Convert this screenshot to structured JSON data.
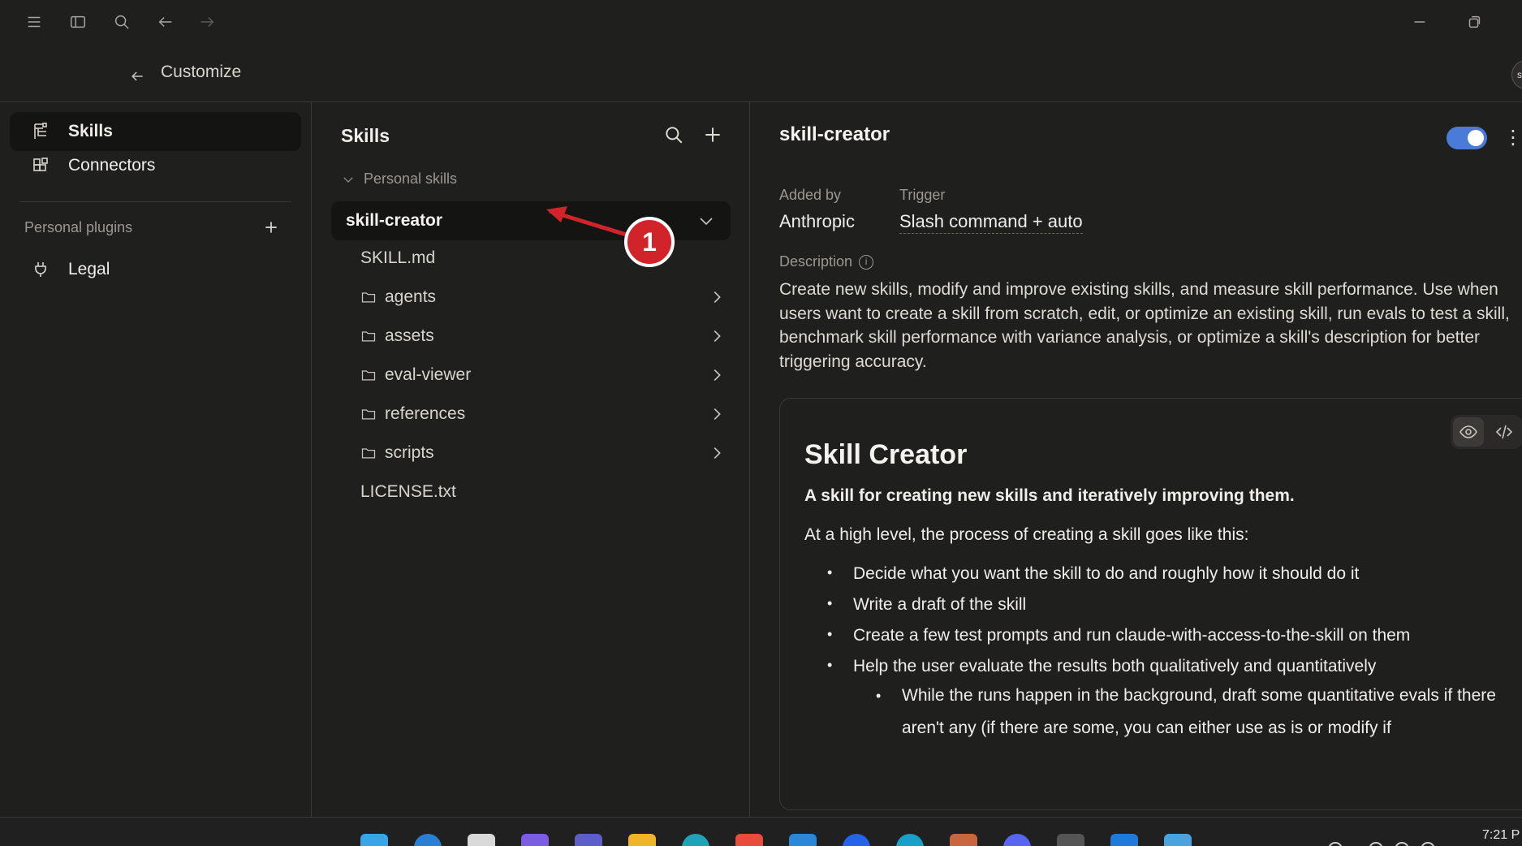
{
  "header": {
    "title": "Customize"
  },
  "avatar": {
    "initial": "s"
  },
  "nav": {
    "items": [
      {
        "label": "Skills",
        "icon": "skills-icon",
        "active": true
      },
      {
        "label": "Connectors",
        "icon": "connectors-icon",
        "active": false
      }
    ],
    "plugins_label": "Personal plugins",
    "plugins": [
      {
        "label": "Legal",
        "icon": "plug-icon"
      }
    ]
  },
  "tree": {
    "title": "Skills",
    "group_label": "Personal skills",
    "selected_skill": "skill-creator",
    "files": [
      {
        "name": "SKILL.md",
        "type": "file"
      },
      {
        "name": "agents",
        "type": "folder"
      },
      {
        "name": "assets",
        "type": "folder"
      },
      {
        "name": "eval-viewer",
        "type": "folder"
      },
      {
        "name": "references",
        "type": "folder"
      },
      {
        "name": "scripts",
        "type": "folder"
      },
      {
        "name": "LICENSE.txt",
        "type": "file"
      }
    ]
  },
  "annotation": {
    "number": "1",
    "color": "#d0242a"
  },
  "detail": {
    "title": "skill-creator",
    "enabled": true,
    "added_by_label": "Added by",
    "added_by_value": "Anthropic",
    "trigger_label": "Trigger",
    "trigger_value": "Slash command + auto",
    "description_label": "Description",
    "description": "Create new skills, modify and improve existing skills, and measure skill performance. Use when users want to create a skill from scratch, edit, or optimize an existing skill, run evals to test a skill, benchmark skill performance with variance analysis, or optimize a skill's description for better triggering accuracy.",
    "doc": {
      "h1": "Skill Creator",
      "intro": "A skill for creating new skills and iteratively improving them.",
      "lead": "At a high level, the process of creating a skill goes like this:",
      "bullets": [
        "Decide what you want the skill to do and roughly how it should do it",
        "Write a draft of the skill",
        "Create a few test prompts and run claude-with-access-to-the-skill on them",
        "Help the user evaluate the results both qualitatively and quantitatively"
      ],
      "sub_bullet": "While the runs happen in the background, draft some quantitative evals if there aren't any (if there are some, you can either use as is or modify if"
    }
  },
  "taskbar": {
    "clock": "7:21 P"
  },
  "colors": {
    "accent": "#4a7bd8",
    "background": "#1f1f1e",
    "selected": "#141413"
  }
}
